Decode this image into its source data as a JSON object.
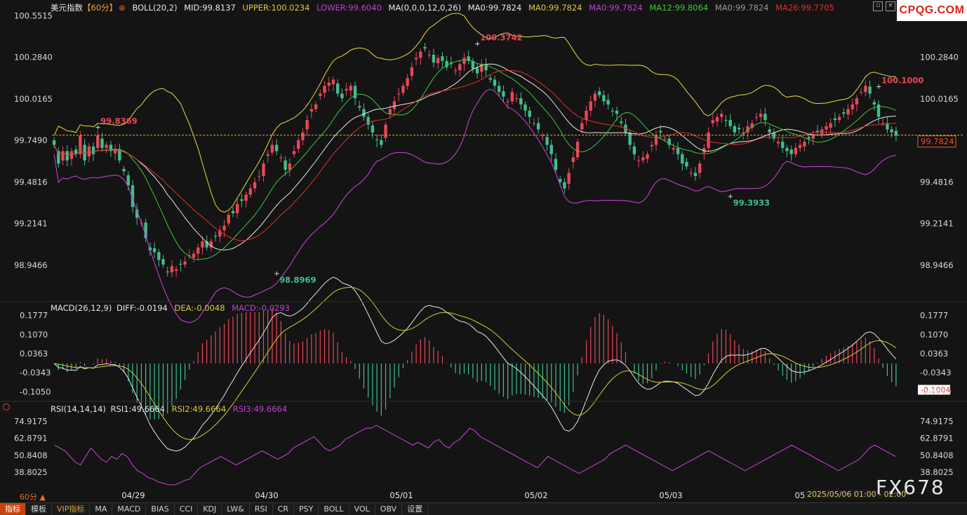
{
  "header": {
    "instrument": "美元指数",
    "period_tag": "【60分】",
    "boll": "BOLL(20,2)",
    "mid": "MID:99.8137",
    "upper": "UPPER:100.0234",
    "lower": "LOWER:99.6040",
    "ma_params": "MA(0,0,0,12,0,26)",
    "ma0a": "MA0:99.7824",
    "ma0b": "MA0:99.7824",
    "ma0c": "MA0:99.7824",
    "ma12": "MA12:99.8064",
    "ma0d": "MA0:99.7824",
    "ma26": "MA26:99.7705"
  },
  "macd_header": {
    "name": "MACD(26,12,9)",
    "diff": "DIFF:-0.0194",
    "dea": "DEA:-0.0048",
    "macd": "MACD:-0.0293"
  },
  "rsi_header": {
    "name": "RSI(14,14,14)",
    "rsi1": "RSI1:49.6664",
    "rsi2": "RSI2:49.6664",
    "rsi3": "RSI3:49.6664"
  },
  "logo_text": "CPQG.COM",
  "watermark": "FX678",
  "date_tooltip": "2025/05/06 01:00 - 02:00",
  "period_label": "60分 ▲",
  "current_price_label": "99.7824",
  "macd_current_label": "-0.1004",
  "toolbar": [
    "指标",
    "模板",
    "VIP指标",
    "MA",
    "MACD",
    "BIAS",
    "CCI",
    "KDJ",
    "LW&",
    "RSI",
    "CR",
    "PSY",
    "BOLL",
    "VOL",
    "OBV",
    "设置"
  ],
  "colors": {
    "up": "#e8485a",
    "down": "#3fbf8f",
    "upper": "#d8cc3a",
    "lower": "#c040d0",
    "ma12": "#3cc83c",
    "ma26": "#e03030",
    "mid": "#e8e8e8",
    "rsi": "#c040d0",
    "dea": "#d8cc3a"
  },
  "chart_data": {
    "type": "candlestick",
    "price_axis_ticks": [
      "100.5515",
      "100.2840",
      "100.0165",
      "99.7490",
      "99.4816",
      "99.2141",
      "98.9466"
    ],
    "price_axis_right_ticks": [
      "100.2840",
      "100.0165",
      "99.4816",
      "99.2141",
      "98.9466"
    ],
    "ylim": [
      98.72,
      100.58
    ],
    "x_labels": [
      "04/29",
      "04/30",
      "05/01",
      "05/02",
      "05/03",
      "05"
    ],
    "annotations": [
      {
        "text": "99.8369",
        "type": "high"
      },
      {
        "text": "98.8969",
        "type": "low"
      },
      {
        "text": "100.3742",
        "type": "high"
      },
      {
        "text": "99.3933",
        "type": "low"
      },
      {
        "text": "100.1000",
        "type": "high"
      }
    ],
    "annotation_values": [
      99.8369,
      98.8969,
      100.3742,
      99.3933,
      100.1
    ],
    "annotation_index": [
      10,
      51,
      97,
      155,
      189
    ],
    "current_price": 99.7824,
    "close": [
      99.72,
      99.6,
      99.68,
      99.62,
      99.68,
      99.66,
      99.78,
      99.62,
      99.71,
      99.66,
      99.78,
      99.7,
      99.72,
      99.68,
      99.69,
      99.62,
      99.55,
      99.46,
      99.32,
      99.25,
      99.22,
      99.12,
      99.04,
      99.03,
      98.98,
      98.95,
      98.9,
      98.94,
      98.92,
      98.95,
      98.97,
      99.01,
      99.02,
      99.06,
      99.1,
      99.06,
      99.1,
      99.13,
      99.17,
      99.2,
      99.27,
      99.28,
      99.34,
      99.36,
      99.4,
      99.44,
      99.48,
      99.52,
      99.6,
      99.66,
      99.72,
      99.68,
      99.64,
      99.56,
      99.6,
      99.68,
      99.75,
      99.8,
      99.88,
      99.95,
      99.98,
      100.05,
      100.1,
      100.12,
      100.14,
      100.05,
      100.02,
      100.08,
      100.1,
      100.02,
      99.96,
      99.9,
      99.85,
      99.8,
      99.75,
      99.72,
      99.85,
      99.95,
      100.0,
      100.05,
      100.1,
      100.15,
      100.22,
      100.28,
      100.32,
      100.34,
      100.3,
      100.25,
      100.28,
      100.26,
      100.22,
      100.24,
      100.2,
      100.24,
      100.28,
      100.26,
      100.21,
      100.18,
      100.24,
      100.2,
      100.14,
      100.1,
      100.06,
      100.03,
      100.0,
      100.06,
      100.02,
      99.98,
      99.94,
      99.9,
      99.86,
      99.82,
      99.78,
      99.72,
      99.66,
      99.56,
      99.48,
      99.44,
      99.54,
      99.64,
      99.74,
      99.86,
      99.94,
      100.0,
      100.05,
      100.04,
      100.0,
      99.98,
      99.94,
      99.92,
      99.86,
      99.8,
      99.72,
      99.66,
      99.62,
      99.64,
      99.66,
      99.72,
      99.78,
      99.8,
      99.76,
      99.72,
      99.7,
      99.66,
      99.6,
      99.58,
      99.54,
      99.52,
      99.6,
      99.7,
      99.8,
      99.88,
      99.9,
      99.92,
      99.88,
      99.84,
      99.8,
      99.82,
      99.8,
      99.84,
      99.86,
      99.9,
      99.92,
      99.88,
      99.8,
      99.76,
      99.74,
      99.7,
      99.68,
      99.66,
      99.7,
      99.72,
      99.74,
      99.76,
      99.78,
      99.8,
      99.82,
      99.84,
      99.86,
      99.88,
      99.9,
      99.92,
      99.95,
      99.98,
      100.02,
      100.06,
      100.1,
      100.05,
      99.98,
      99.9,
      99.86,
      99.82,
      99.8,
      99.78
    ],
    "upper": [
      99.78,
      99.8,
      99.82,
      99.86,
      99.92,
      99.98,
      100.0,
      100.02,
      100.04,
      100.05,
      100.06,
      100.06,
      100.05,
      100.02,
      99.99,
      99.96,
      99.94,
      99.9,
      99.84,
      99.74,
      99.62,
      99.52,
      99.44,
      99.38,
      99.36,
      99.34,
      99.33,
      99.32,
      99.32,
      99.31,
      99.3,
      99.3,
      99.3,
      99.3,
      99.3,
      99.3,
      99.31,
      99.32,
      99.34,
      99.36,
      99.38,
      99.4,
      99.42,
      99.46,
      99.52,
      99.58,
      99.66,
      99.74,
      99.8,
      99.86,
      99.9,
      99.93,
      99.95,
      99.96,
      99.98,
      100.02,
      100.08,
      100.14,
      100.2,
      100.26,
      100.3,
      100.34,
      100.38,
      100.4,
      100.42,
      100.42,
      100.4,
      100.38,
      100.34,
      100.3,
      100.26,
      100.22,
      100.18,
      100.14,
      100.1,
      100.08,
      100.06,
      100.05,
      100.04,
      100.03,
      100.02,
      100.02,
      100.02,
      100.02,
      100.02,
      100.02,
      100.02,
      100.02,
      100.02,
      100.02,
      100.02,
      100.02,
      100.02,
      100.02,
      100.02,
      100.03,
      100.04,
      100.06,
      100.09,
      100.12,
      100.14,
      100.16,
      100.16,
      100.15,
      100.14,
      100.13,
      100.12,
      100.11,
      100.1,
      100.1,
      100.1,
      100.1,
      100.1,
      100.1,
      100.1,
      100.1,
      100.1,
      100.1,
      100.1,
      100.1,
      100.1,
      100.1,
      100.1,
      100.1,
      100.1,
      100.1,
      100.1,
      100.1,
      100.1,
      100.1,
      100.1,
      100.1,
      100.1,
      100.1,
      100.1,
      100.1,
      100.1,
      100.1,
      100.1,
      100.1,
      100.1,
      100.1,
      100.1,
      100.1,
      100.1,
      100.1,
      100.1,
      100.1,
      100.1,
      100.1,
      100.1,
      100.1,
      100.1,
      100.1,
      100.1,
      100.1,
      100.1,
      100.1,
      100.1,
      100.1,
      100.1,
      100.1,
      100.1,
      100.1,
      100.1,
      100.1,
      100.1,
      100.1,
      100.1,
      100.1,
      100.1,
      100.1,
      100.1,
      100.1,
      100.1,
      100.1,
      100.1,
      100.1,
      100.1,
      100.1,
      100.1,
      100.1,
      100.1,
      100.1,
      100.1,
      100.1,
      100.1,
      100.1,
      100.1,
      100.1,
      100.1,
      100.1,
      100.1,
      100.1,
      100.1,
      100.1,
      100.1,
      100.1
    ],
    "macd_axis_ticks": [
      "0.1777",
      "0.1070",
      "0.0363",
      "-0.0343",
      "-0.1050"
    ],
    "macd_ylim": [
      -0.125,
      0.19
    ],
    "rsi_axis_ticks": [
      "74.9175",
      "62.8791",
      "50.8408",
      "38.8025"
    ],
    "rsi_ylim": [
      28,
      80
    ],
    "rsi": [
      58,
      56,
      54,
      50,
      46,
      44,
      50,
      56,
      52,
      48,
      46,
      50,
      48,
      52,
      50,
      44,
      40,
      38,
      35,
      34,
      32,
      31,
      30,
      30,
      31,
      33,
      34,
      38,
      42,
      44,
      46,
      48,
      50,
      48,
      46,
      44,
      46,
      48,
      50,
      52,
      54,
      52,
      50,
      48,
      50,
      52,
      56,
      58,
      60,
      62,
      64,
      60,
      56,
      54,
      56,
      58,
      62,
      64,
      66,
      68,
      70,
      70,
      72,
      70,
      68,
      66,
      64,
      62,
      60,
      58,
      60,
      58,
      56,
      60,
      62,
      58,
      56,
      60,
      62,
      66,
      70,
      68,
      64,
      62,
      60,
      58,
      56,
      54,
      52,
      50,
      48,
      46,
      44,
      42,
      46,
      50,
      48,
      46,
      44,
      42,
      40,
      38,
      40,
      42,
      44,
      46,
      48,
      52,
      54,
      56,
      58,
      56,
      54,
      52,
      50,
      48,
      46,
      44,
      42,
      40,
      42,
      44,
      46,
      48,
      50,
      52,
      54,
      52,
      50,
      48,
      46,
      44,
      42,
      40,
      42,
      44,
      46,
      48,
      50,
      52,
      54,
      56,
      58,
      56,
      54,
      52,
      50,
      48,
      46,
      44,
      42,
      40,
      42,
      44,
      46,
      48,
      52,
      56,
      58,
      56,
      54,
      52,
      50
    ]
  }
}
